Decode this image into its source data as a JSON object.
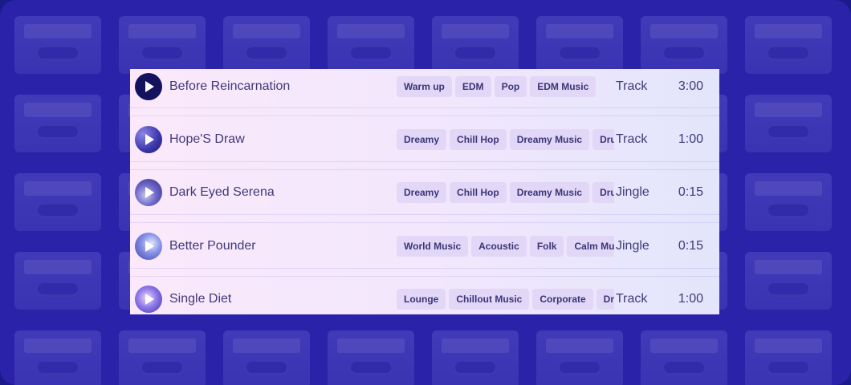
{
  "tracks": [
    {
      "title": "Before Reincarnation",
      "tags": [
        "Warm up",
        "EDM",
        "Pop",
        "EDM Music"
      ],
      "type": "Track",
      "duration": "3:00"
    },
    {
      "title": "Hope'S Draw",
      "tags": [
        "Dreamy",
        "Chill Hop",
        "Dreamy Music",
        "Drum"
      ],
      "type": "Track",
      "duration": "1:00"
    },
    {
      "title": "Dark Eyed Serena",
      "tags": [
        "Dreamy",
        "Chill Hop",
        "Dreamy Music",
        "Drum"
      ],
      "type": "Jingle",
      "duration": "0:15"
    },
    {
      "title": "Better Pounder",
      "tags": [
        "World Music",
        "Acoustic",
        "Folk",
        "Calm Music"
      ],
      "type": "Jingle",
      "duration": "0:15"
    },
    {
      "title": "Single Diet",
      "tags": [
        "Lounge",
        "Chillout Music",
        "Corporate",
        "Drum"
      ],
      "type": "Track",
      "duration": "1:00"
    }
  ],
  "icons": {
    "play": "play-icon"
  },
  "colors": {
    "background": "#2b26a8",
    "panel": "#f3e7fc",
    "text": "#3f3a78",
    "tag": "#e0d4f6"
  }
}
